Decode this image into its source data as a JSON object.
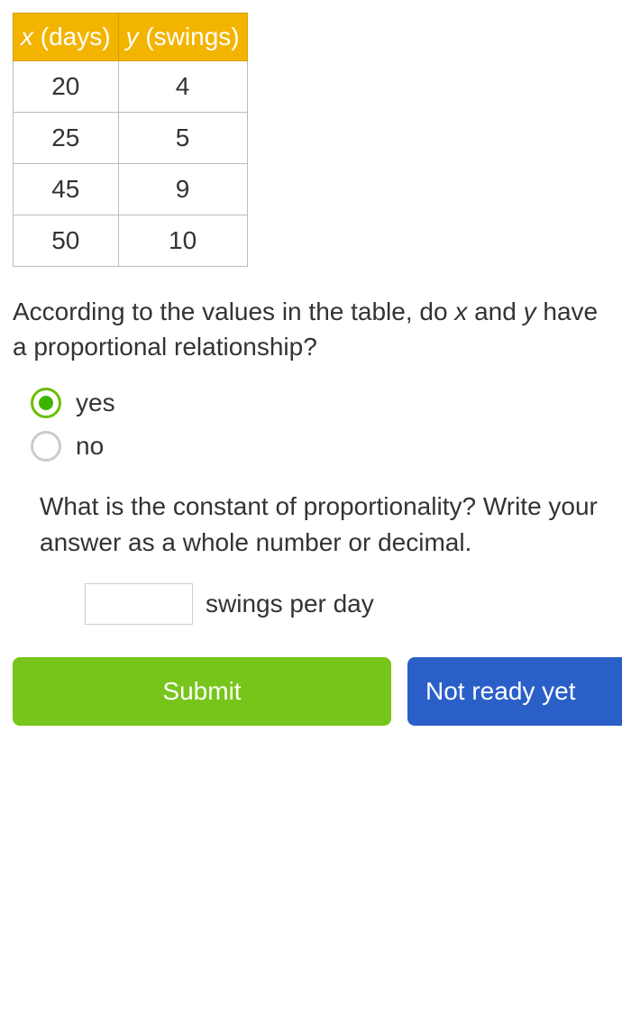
{
  "chart_data": {
    "type": "table",
    "columns": [
      {
        "var": "x",
        "label": "(days)"
      },
      {
        "var": "y",
        "label": "(swings)"
      }
    ],
    "rows": [
      {
        "x": "20",
        "y": "4"
      },
      {
        "x": "25",
        "y": "5"
      },
      {
        "x": "45",
        "y": "9"
      },
      {
        "x": "50",
        "y": "10"
      }
    ]
  },
  "question1": {
    "prefix": "According to the values in the table, do ",
    "var1": "x",
    "mid": " and ",
    "var2": "y",
    "suffix": " have a proportional relationship?"
  },
  "options": {
    "yes": "yes",
    "no": "no",
    "selected": "yes"
  },
  "question2": "What is the constant of proportionality? Write your answer as a whole number or decimal.",
  "answer": {
    "value": "",
    "unit": "swings per day"
  },
  "buttons": {
    "submit": "Submit",
    "not_ready": "Not ready yet"
  }
}
